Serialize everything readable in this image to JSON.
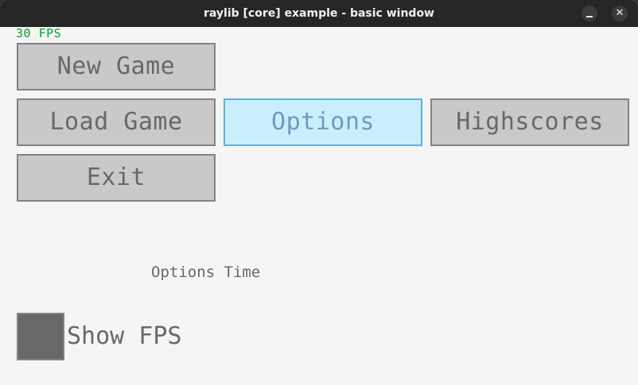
{
  "window": {
    "title": "raylib [core] example - basic window",
    "minimize_glyph": "",
    "close_glyph": "✕"
  },
  "fps": {
    "label": "30 FPS"
  },
  "menu": {
    "new_game": "New Game",
    "load_game": "Load Game",
    "options": "Options",
    "highscores": "Highscores",
    "exit": "Exit",
    "active_item": "Options"
  },
  "screen": {
    "label": "Options Time"
  },
  "settings": {
    "show_fps_label": "Show FPS",
    "show_fps_checked": true
  },
  "colors": {
    "fps_text": "#00a12e",
    "button_bg": "#c9c9c9",
    "button_border": "#838383",
    "button_text": "#686868",
    "active_bg": "#c9effe",
    "active_border": "#5bb2d9",
    "active_text": "#6c9bbc",
    "background": "#f5f5f5"
  },
  "icons": {
    "minimize": "minimize-icon",
    "close": "close-icon"
  }
}
